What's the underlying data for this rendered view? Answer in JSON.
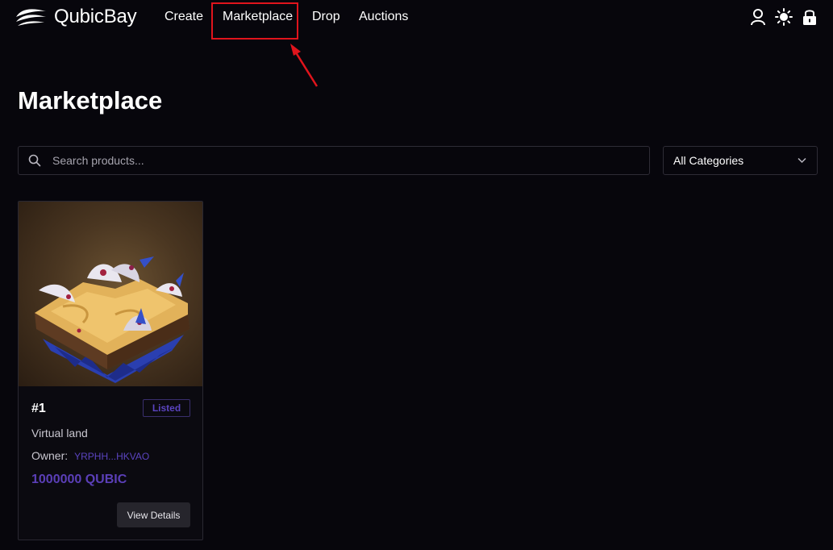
{
  "header": {
    "brand": "QubicBay",
    "nav": [
      {
        "label": "Create"
      },
      {
        "label": "Marketplace"
      },
      {
        "label": "Drop"
      },
      {
        "label": "Auctions"
      }
    ],
    "icons": [
      "user-icon",
      "sun-icon",
      "lock-icon"
    ]
  },
  "page": {
    "title": "Marketplace"
  },
  "search": {
    "placeholder": "Search products...",
    "value": ""
  },
  "category_filter": {
    "selected": "All Categories"
  },
  "products": [
    {
      "title": "#1",
      "status": "Listed",
      "category": "Virtual land",
      "owner_label": "Owner:",
      "owner": "YRPHH...HKVAO",
      "price": "1000000 QUBIC",
      "action_label": "View Details"
    }
  ],
  "colors": {
    "background": "#07060c",
    "accent": "#5b44c0",
    "highlight": "#e0141c"
  }
}
